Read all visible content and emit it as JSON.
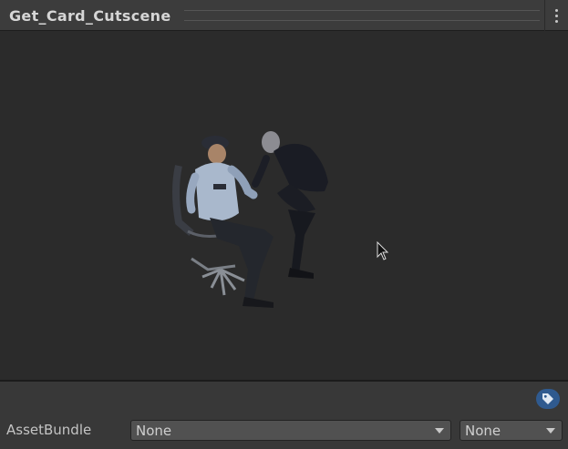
{
  "header": {
    "title": "Get_Card_Cutscene",
    "menu_icon": "kebab-menu-icon"
  },
  "preview": {
    "content": "3d-model-preview",
    "cursor_icon": "arrow-cursor-icon"
  },
  "footer": {
    "label_icon": "tag-icon",
    "label_icon_color": "#2f5a8f",
    "assetbundle_label": "AssetBundle",
    "assetbundle_value": "None",
    "variant_value": "None"
  }
}
